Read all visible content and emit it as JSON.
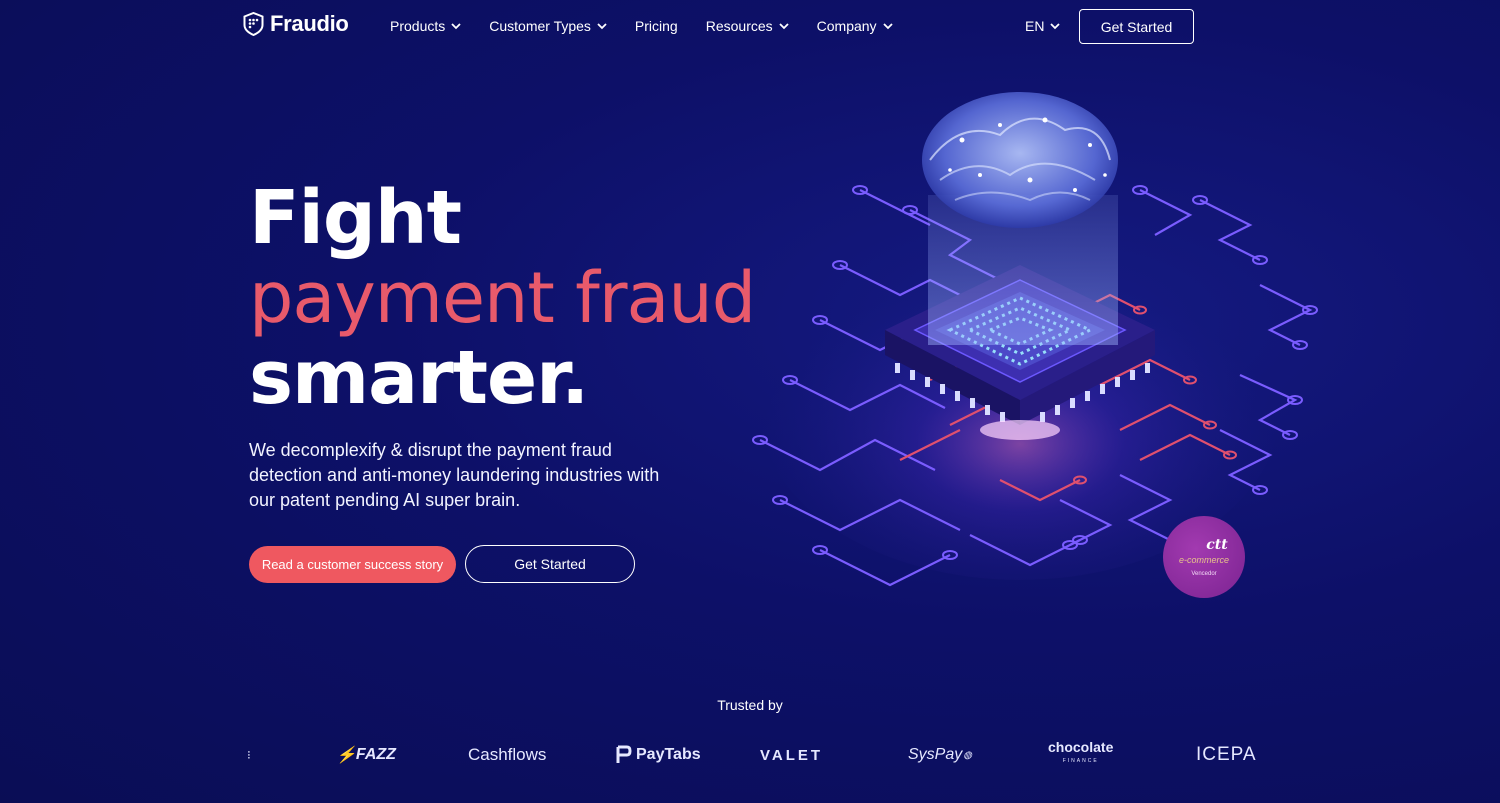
{
  "nav": {
    "brand": "Fraudio",
    "items": [
      {
        "label": "Products",
        "has_dropdown": true
      },
      {
        "label": "Customer Types",
        "has_dropdown": true
      },
      {
        "label": "Pricing",
        "has_dropdown": false
      },
      {
        "label": "Resources",
        "has_dropdown": true
      },
      {
        "label": "Company",
        "has_dropdown": true
      }
    ],
    "language": "EN",
    "cta": "Get Started"
  },
  "hero": {
    "line1": "Fight",
    "line2": "payment fraud",
    "line3": "smarter.",
    "subtitle": "We decomplexify & disrupt the payment fraud detection and anti-money laundering industries with our patent pending AI super brain.",
    "primary_button": "Read a customer success story",
    "secondary_button": "Get Started"
  },
  "award_badge": {
    "brand": "ctt",
    "title": "e-commerce",
    "subtitle": "Vencedor"
  },
  "trusted": {
    "label": "Trusted by",
    "logos": [
      "FAZZ",
      "Cashflows",
      "PayTabs",
      "VALET",
      "SysPay",
      "chocolate",
      "ICEPA"
    ]
  },
  "colors": {
    "background": "#0c0f5e",
    "accent": "#e85a6b",
    "button_primary": "#ef5860",
    "badge": "#8a2aa0"
  }
}
